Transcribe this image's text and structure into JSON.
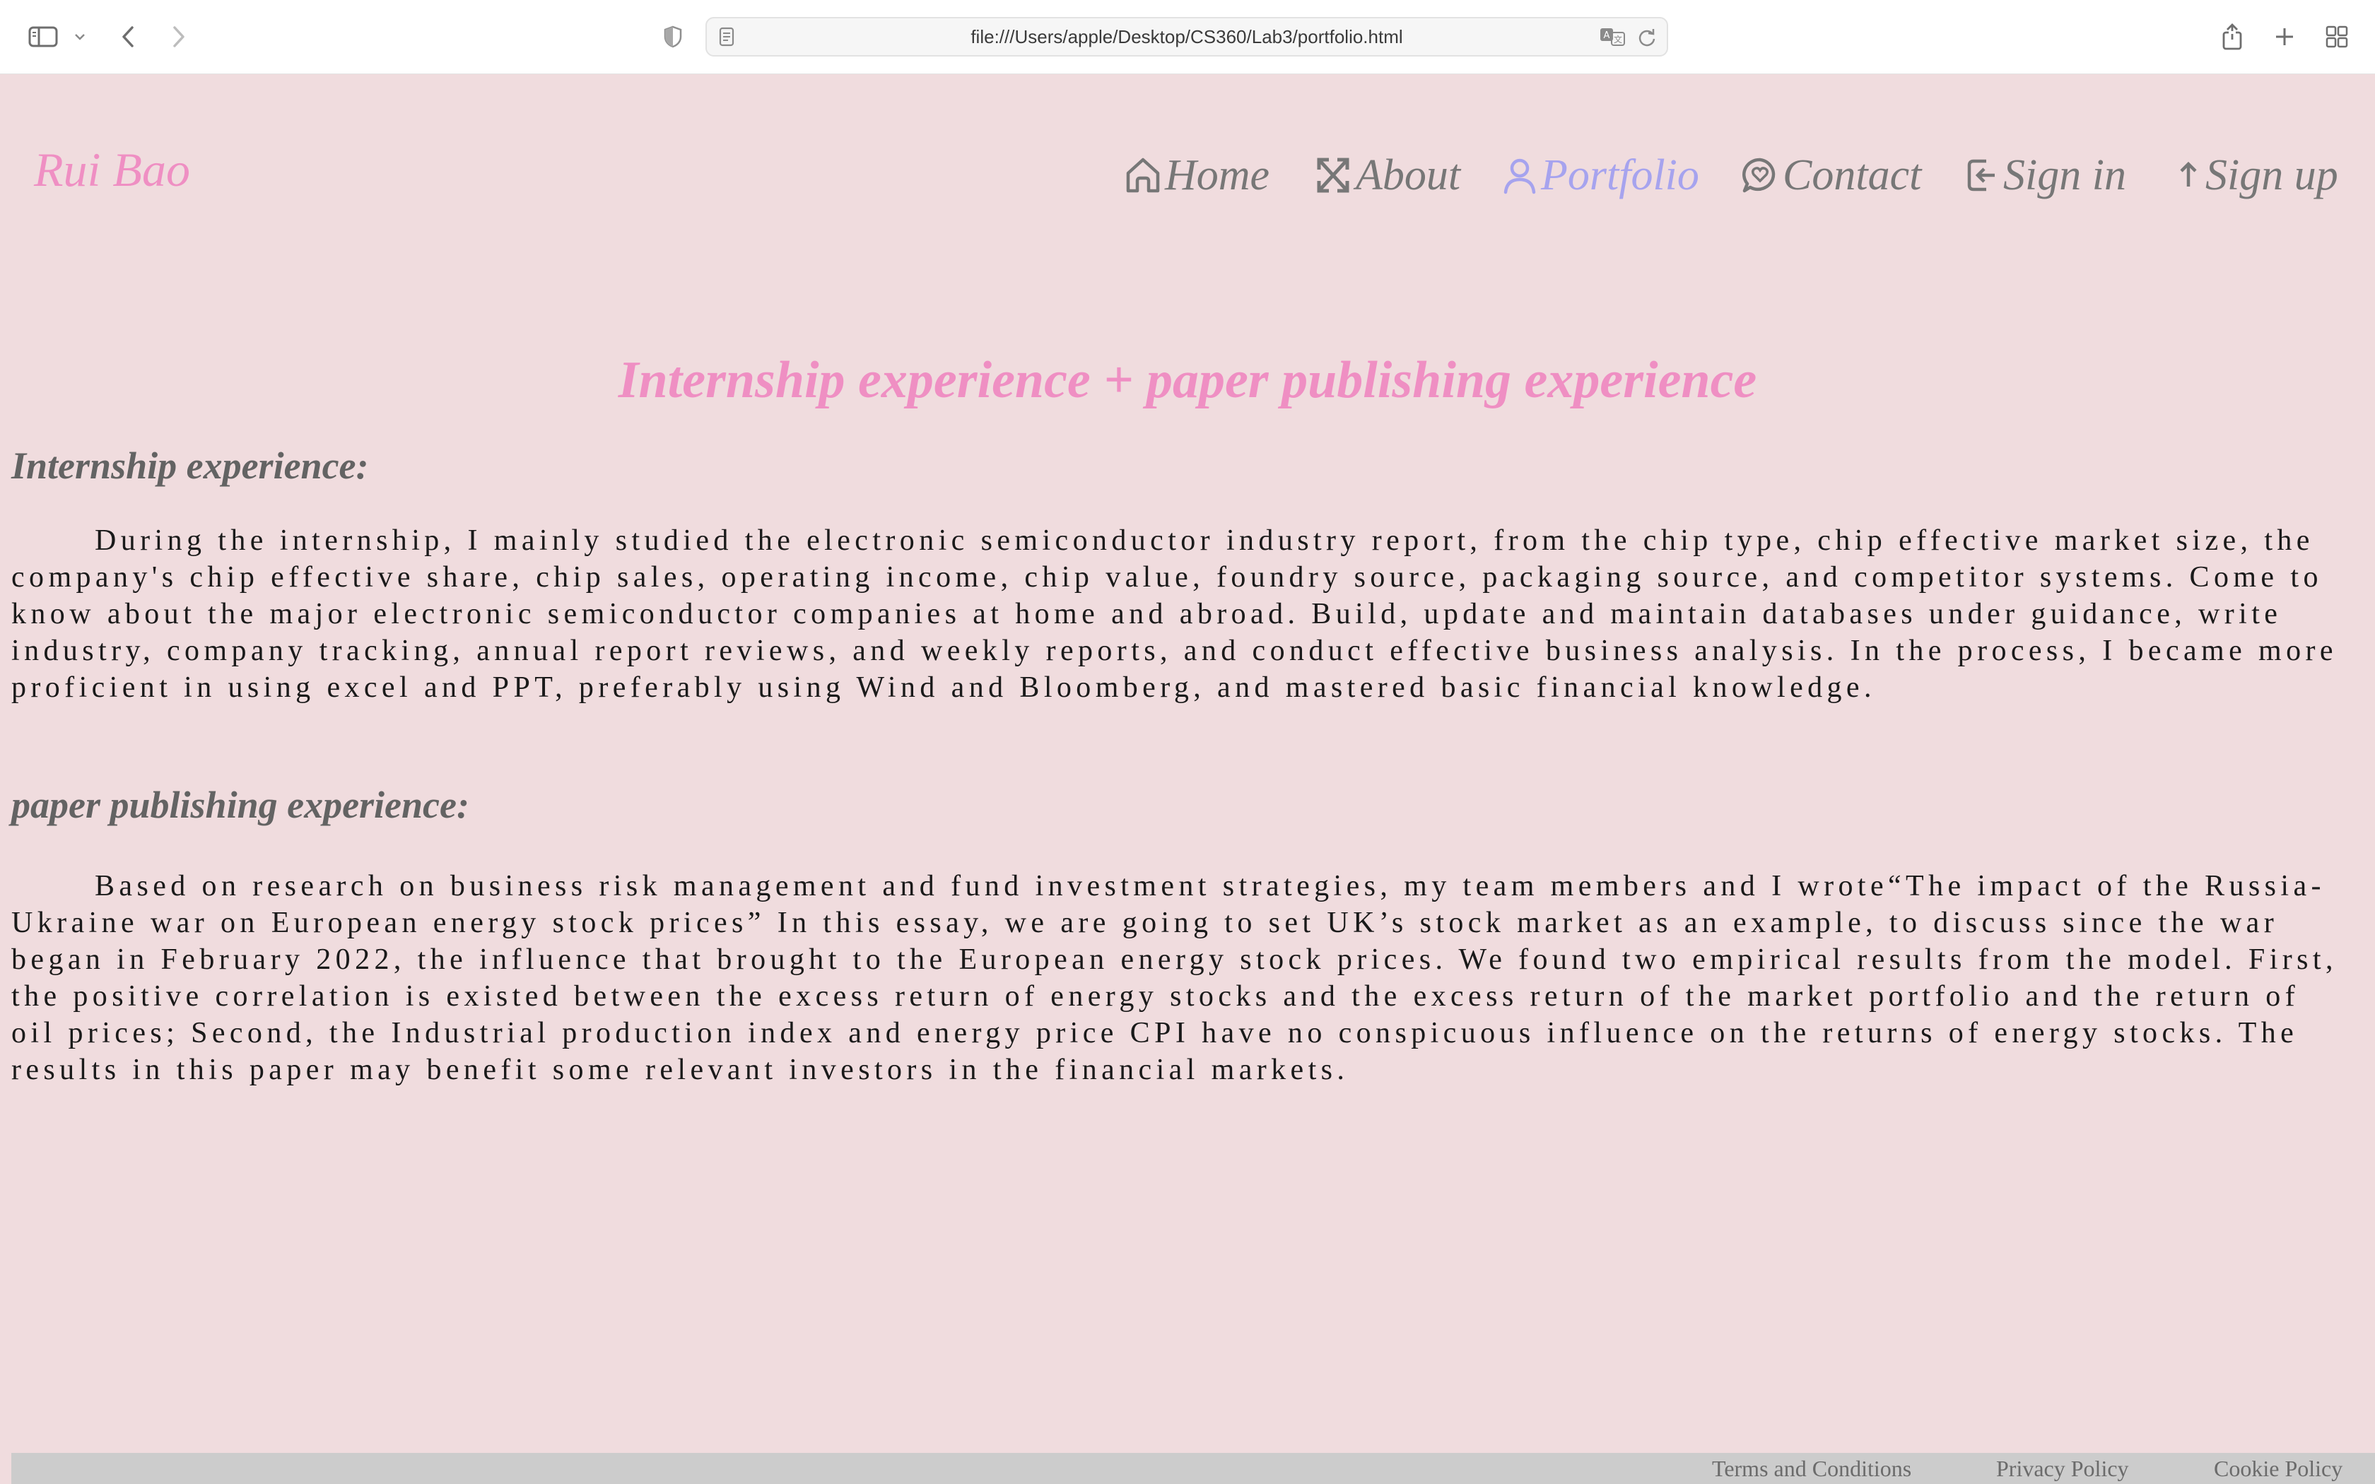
{
  "browser": {
    "url": "file:///Users/apple/Desktop/CS360/Lab3/portfolio.html",
    "icons": [
      "sidebar-icon",
      "chevron-down-icon",
      "back-icon",
      "forward-icon",
      "privacy-shield-icon",
      "page-icon",
      "translate-icon",
      "reload-icon",
      "share-icon",
      "new-tab-icon",
      "tab-overview-icon"
    ]
  },
  "site": {
    "logo": "Rui Bao",
    "nav": [
      {
        "label": "Home",
        "icon": "home-icon"
      },
      {
        "label": "About",
        "icon": "expand-arrows-icon"
      },
      {
        "label": "Portfolio",
        "icon": "person-icon",
        "active": true
      },
      {
        "label": "Contact",
        "icon": "chat-heart-icon"
      },
      {
        "label": "Sign in",
        "icon": "sign-in-icon"
      },
      {
        "label": "Sign up",
        "icon": "arrow-up-icon"
      }
    ]
  },
  "main": {
    "title": "Internship experience + paper publishing experience",
    "sections": [
      {
        "heading": "Internship experience:",
        "body": "During the internship, I mainly studied the electronic semiconductor industry report, from the chip type, chip effective market size, the company's chip effective share, chip sales, operating income, chip value, foundry source, packaging source, and competitor systems. Come to know about the major electronic semiconductor companies at home and abroad. Build, update and maintain databases under guidance, write industry, company tracking, annual report reviews, and weekly reports, and conduct effective business analysis. In the process, I became more proficient in using excel and PPT, preferably using Wind and Bloomberg, and mastered basic financial knowledge."
      },
      {
        "heading": "paper publishing experience:",
        "body": "Based on research on business risk management and fund investment strategies, my team members and I wrote“The impact of the Russia-Ukraine war on European energy stock prices” In this essay, we are going to set UK’s stock market as an example, to discuss since the war began in February 2022, the influence that brought to the European energy stock prices. We found two empirical results from the model. First, the positive correlation is existed between the excess return of energy stocks and the excess return of the market portfolio and the return of oil prices; Second, the Industrial production index and energy price CPI have no conspicuous influence on the returns of energy stocks. The results in this paper may benefit some relevant investors in the financial markets."
      }
    ]
  },
  "footer": {
    "links": [
      "Terms and Conditions",
      "Privacy Policy",
      "Cookie Policy"
    ]
  },
  "colors": {
    "background": "#f0dcde",
    "accent_pink": "#ef8fc3",
    "active_nav": "#a6a3ee",
    "nav_gray": "#777777",
    "footer_bg": "#cccccc"
  }
}
